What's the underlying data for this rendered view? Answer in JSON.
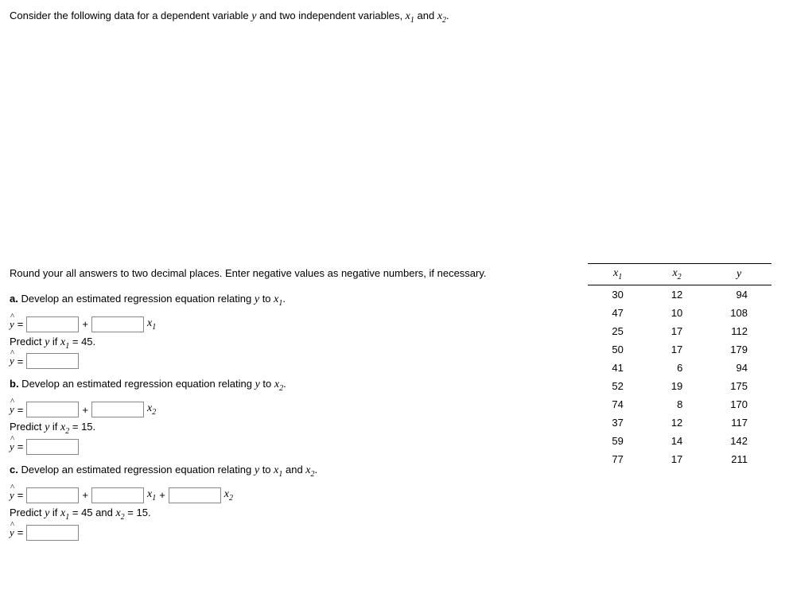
{
  "intro": "Consider the following data for a dependent variable y and two independent variables, x₁ and x₂.",
  "table": {
    "headers": {
      "c1": "x₁",
      "c2": "x₂",
      "c3": "y"
    },
    "rows": [
      {
        "x1": "30",
        "x2": "12",
        "y": "94"
      },
      {
        "x1": "47",
        "x2": "10",
        "y": "108"
      },
      {
        "x1": "25",
        "x2": "17",
        "y": "112"
      },
      {
        "x1": "50",
        "x2": "17",
        "y": "179"
      },
      {
        "x1": "41",
        "x2": "6",
        "y": "94"
      },
      {
        "x1": "52",
        "x2": "19",
        "y": "175"
      },
      {
        "x1": "74",
        "x2": "8",
        "y": "170"
      },
      {
        "x1": "37",
        "x2": "12",
        "y": "117"
      },
      {
        "x1": "59",
        "x2": "14",
        "y": "142"
      },
      {
        "x1": "77",
        "x2": "17",
        "y": "211"
      }
    ]
  },
  "instruction": "Round your all answers to two decimal places. Enter negative values as negative numbers, if necessary.",
  "parts": {
    "a": {
      "label": "a.",
      "text": "Develop an estimated regression equation relating y to x₁.",
      "predict_text": "Predict y if x₁ = 45.",
      "yhat": "ŷ =",
      "plus": "+",
      "var1": "x₁"
    },
    "b": {
      "label": "b.",
      "text": "Develop an estimated regression equation relating y to x₂.",
      "predict_text": "Predict y if x₂ = 15.",
      "yhat": "ŷ =",
      "plus": "+",
      "var2": "x₂"
    },
    "c": {
      "label": "c.",
      "text": "Develop an estimated regression equation relating y to x₁ and x₂.",
      "predict_text": "Predict y if x₁ = 45 and x₂ = 15.",
      "yhat": "ŷ =",
      "plus": "+",
      "var1plus": "x₁ +",
      "var2": "x₂"
    }
  }
}
